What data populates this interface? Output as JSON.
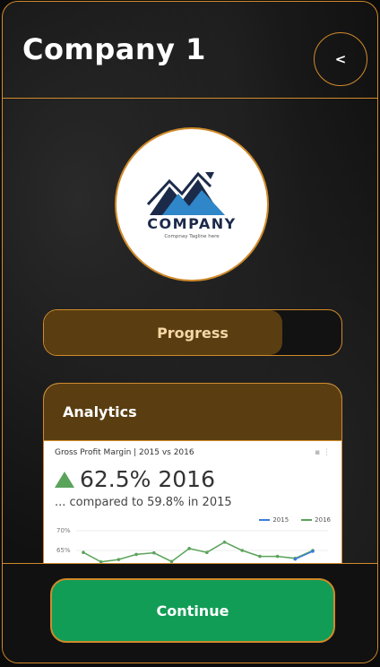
{
  "header": {
    "title": "Company 1",
    "back_label": "<"
  },
  "logo": {
    "wordmark": "COMPANY",
    "tagline": "Compnay Tagline here"
  },
  "progress": {
    "label": "Progress",
    "value_percent": 80
  },
  "analytics": {
    "title": "Analytics",
    "chart_title": "Gross Profit Margin | 2015 vs 2016",
    "kpi_value": "62.5% 2016",
    "kpi_sub": "... compared to 59.8% in 2015",
    "legend": [
      "2015",
      "2016"
    ],
    "y_ticks": [
      "70%",
      "65%"
    ]
  },
  "chart_data": {
    "type": "line",
    "title": "Gross Profit Margin | 2015 vs 2016",
    "ylim": [
      60,
      70
    ],
    "series": [
      {
        "name": "2015",
        "color": "#3b7dd8",
        "values": [
          null,
          null,
          null,
          null,
          null,
          null,
          null,
          null,
          null,
          null,
          null,
          null,
          62.8,
          64.8
        ]
      },
      {
        "name": "2016",
        "color": "#5aa35a",
        "values": [
          64.5,
          62.1,
          62.7,
          64.0,
          64.4,
          62.2,
          65.5,
          64.5,
          67.1,
          65.0,
          63.5,
          63.5,
          63.0,
          65.0
        ]
      }
    ]
  },
  "footer": {
    "continue_label": "Continue"
  },
  "colors": {
    "accent": "#d08a2a",
    "progress_fill": "#5a3e11",
    "button": "#129d57"
  }
}
